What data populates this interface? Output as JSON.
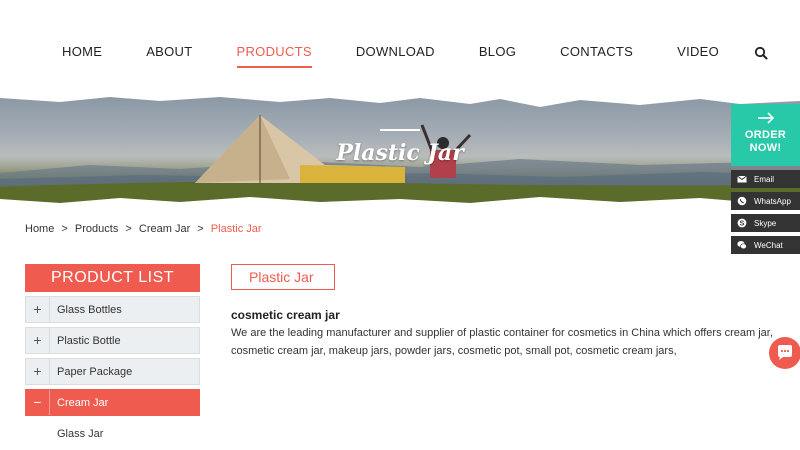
{
  "nav": {
    "items": [
      {
        "label": "HOME"
      },
      {
        "label": "ABOUT"
      },
      {
        "label": "PRODUCTS"
      },
      {
        "label": "DOWNLOAD"
      },
      {
        "label": "BLOG"
      },
      {
        "label": "CONTACTS"
      },
      {
        "label": "VIDEO"
      }
    ],
    "active_index": 2,
    "search_icon": "search-icon"
  },
  "banner": {
    "title": "Plastic Jar"
  },
  "breadcrumb": {
    "home": "Home",
    "sep": ">",
    "products": "Products",
    "cream_jar": "Cream Jar",
    "current": "Plastic Jar"
  },
  "sidebar": {
    "title": "PRODUCT LIST",
    "items": [
      {
        "sign": "+",
        "label": "Glass Bottles"
      },
      {
        "sign": "+",
        "label": "Plastic Bottle"
      },
      {
        "sign": "+",
        "label": "Paper Package"
      },
      {
        "sign": "−",
        "label": "Cream Jar"
      }
    ],
    "sub_items": [
      {
        "label": "Glass Jar"
      }
    ]
  },
  "main": {
    "tag": "Plastic Jar",
    "heading": "cosmetic cream jar",
    "text": "We are the leading manufacturer and supplier of plastic container for cosmetics in China which offers cream jar, cosmetic cream jar, makeup jars, powder jars, cosmetic pot, small pot, cosmetic cream jars,"
  },
  "floating": {
    "order_line1": "ORDER",
    "order_line2": "NOW!",
    "contacts": [
      {
        "label": "Email",
        "icon": "envelope-icon"
      },
      {
        "label": "WhatsApp",
        "icon": "whatsapp-icon"
      },
      {
        "label": "Skype",
        "icon": "skype-icon"
      },
      {
        "label": "WeChat",
        "icon": "wechat-icon"
      }
    ]
  },
  "colors": {
    "accent": "#ef5b4f",
    "order_green": "#27c9a8",
    "contact_dark": "#333333"
  }
}
